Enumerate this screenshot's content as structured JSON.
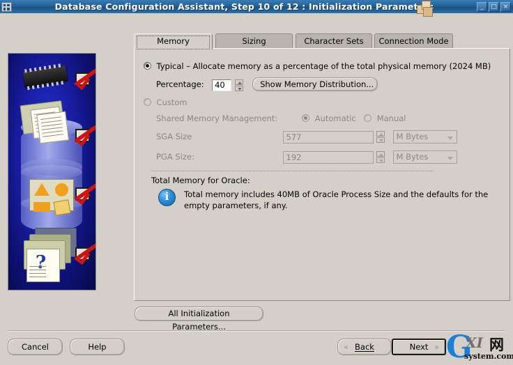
{
  "window": {
    "title": "Database Configuration Assistant, Step 10 of 12 : Initialization Parameters",
    "minimize_label": "_",
    "maximize_label": "□",
    "close_label": "×"
  },
  "tabs": [
    {
      "label": "Memory",
      "selected": true
    },
    {
      "label": "Sizing",
      "selected": false
    },
    {
      "label": "Character Sets",
      "selected": false
    },
    {
      "label": "Connection Mode",
      "selected": false
    }
  ],
  "memory_tab": {
    "typical": {
      "selected": true,
      "label": "Typical – Allocate memory as a percentage of the total physical memory (2024 MB)",
      "percentage_label": "Percentage:",
      "percentage_value": "40",
      "show_distribution_button": "Show Memory Distribution..."
    },
    "custom": {
      "selected": false,
      "label": "Custom",
      "shared_memory_label": "Shared Memory Management:",
      "automatic_label": "Automatic",
      "automatic_selected": true,
      "manual_label": "Manual",
      "manual_selected": false,
      "sga_label": "SGA Size",
      "sga_value": "577",
      "sga_unit": "M Bytes",
      "pga_label": "PGA Size:",
      "pga_value": "192",
      "pga_unit": "M Bytes"
    },
    "total_memory": {
      "heading": "Total Memory for Oracle:",
      "info_text_line1": "Total memory includes 40MB of Oracle Process Size and the defaults for the",
      "info_text_line2": "empty parameters, if any."
    }
  },
  "all_params_button": "All Initialization Parameters...",
  "footer": {
    "cancel": "Cancel",
    "help": "Help",
    "back": "Back",
    "back_chevron": "«",
    "next": "Next",
    "next_chevron": "»"
  },
  "watermark": {
    "g": "G",
    "xi": "XI",
    "cn": "网",
    "domain": "system.com"
  },
  "colors": {
    "titlebar": "#246194",
    "face": "#d4d0c8",
    "sidebar_blue": "#191fa8",
    "check_red": "#cc1414",
    "info_blue": "#2f8fd8"
  }
}
